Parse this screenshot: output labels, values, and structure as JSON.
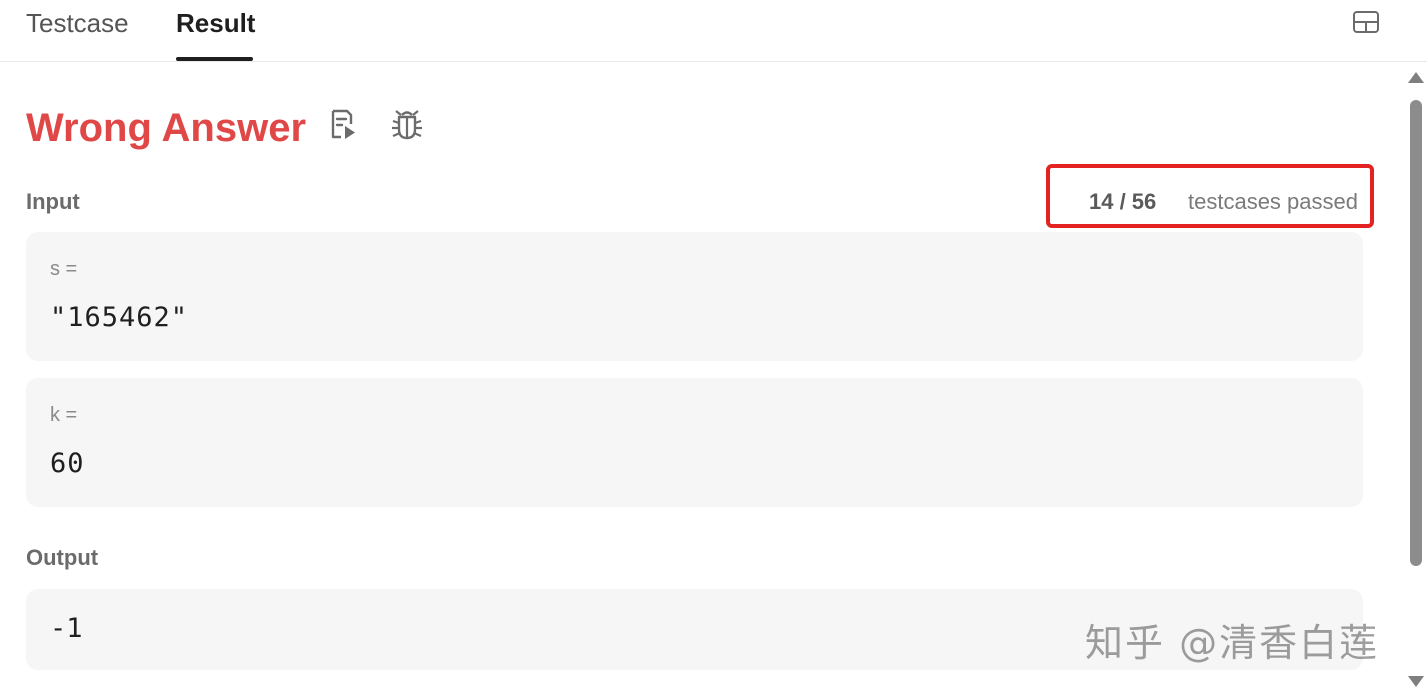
{
  "tabs": {
    "testcase_label": "Testcase",
    "result_label": "Result",
    "active": "Result"
  },
  "toolbar": {
    "layout_icon": "panel-layout-icon"
  },
  "result": {
    "status": "Wrong Answer",
    "status_color": "#e04848",
    "icons": [
      "editorial-icon",
      "debug-icon"
    ],
    "input_label": "Input",
    "passed_count": "14 / 56",
    "passed_text": "testcases passed",
    "highlight_color": "#e32222",
    "inputs": [
      {
        "name": "s =",
        "value": "\"165462\""
      },
      {
        "name": "k =",
        "value": "60"
      }
    ],
    "output_label": "Output",
    "output_value": "-1"
  },
  "watermark": "知乎 @清香白莲"
}
